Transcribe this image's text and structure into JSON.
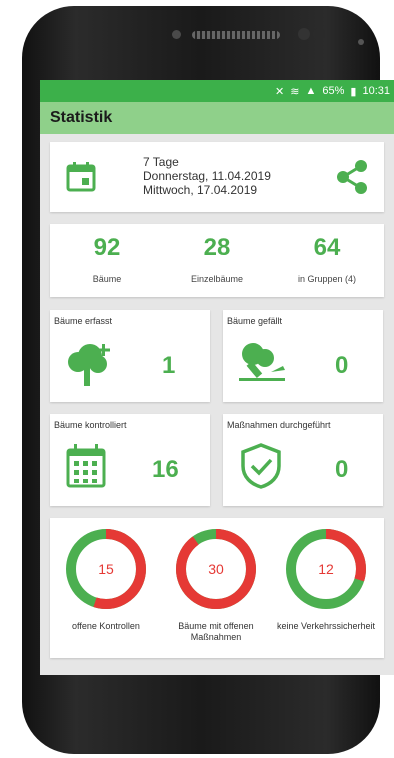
{
  "status": {
    "battery": "65%",
    "time": "10:31"
  },
  "appbar": {
    "title": "Statistik"
  },
  "period": {
    "label": "7 Tage",
    "start": "Donnerstag, 11.04.2019",
    "end": "Mittwoch, 17.04.2019"
  },
  "stats": [
    {
      "value": "92",
      "label": "Bäume"
    },
    {
      "value": "28",
      "label": "Einzelbäume"
    },
    {
      "value": "64",
      "label": "in Gruppen (4)"
    }
  ],
  "tiles": {
    "erfasst": {
      "label": "Bäume erfasst",
      "value": "1"
    },
    "gefaellt": {
      "label": "Bäume gefällt",
      "value": "0"
    },
    "kontrolliert": {
      "label": "Bäume kontrolliert",
      "value": "16"
    },
    "massnahmen": {
      "label": "Maßnahmen durchgeführt",
      "value": "0"
    }
  },
  "rings": [
    {
      "value": "15",
      "label": "offene Kontrollen",
      "fraction": 0.55
    },
    {
      "value": "30",
      "label": "Bäume mit offenen Maßnahmen",
      "fraction": 0.9
    },
    {
      "value": "12",
      "label": "keine Verkehrssicherheit",
      "fraction": 0.3
    }
  ],
  "colors": {
    "accent": "#4caf50",
    "danger": "#e53935",
    "appbar": "#8fd08a",
    "statusbar": "#3cb04a"
  }
}
